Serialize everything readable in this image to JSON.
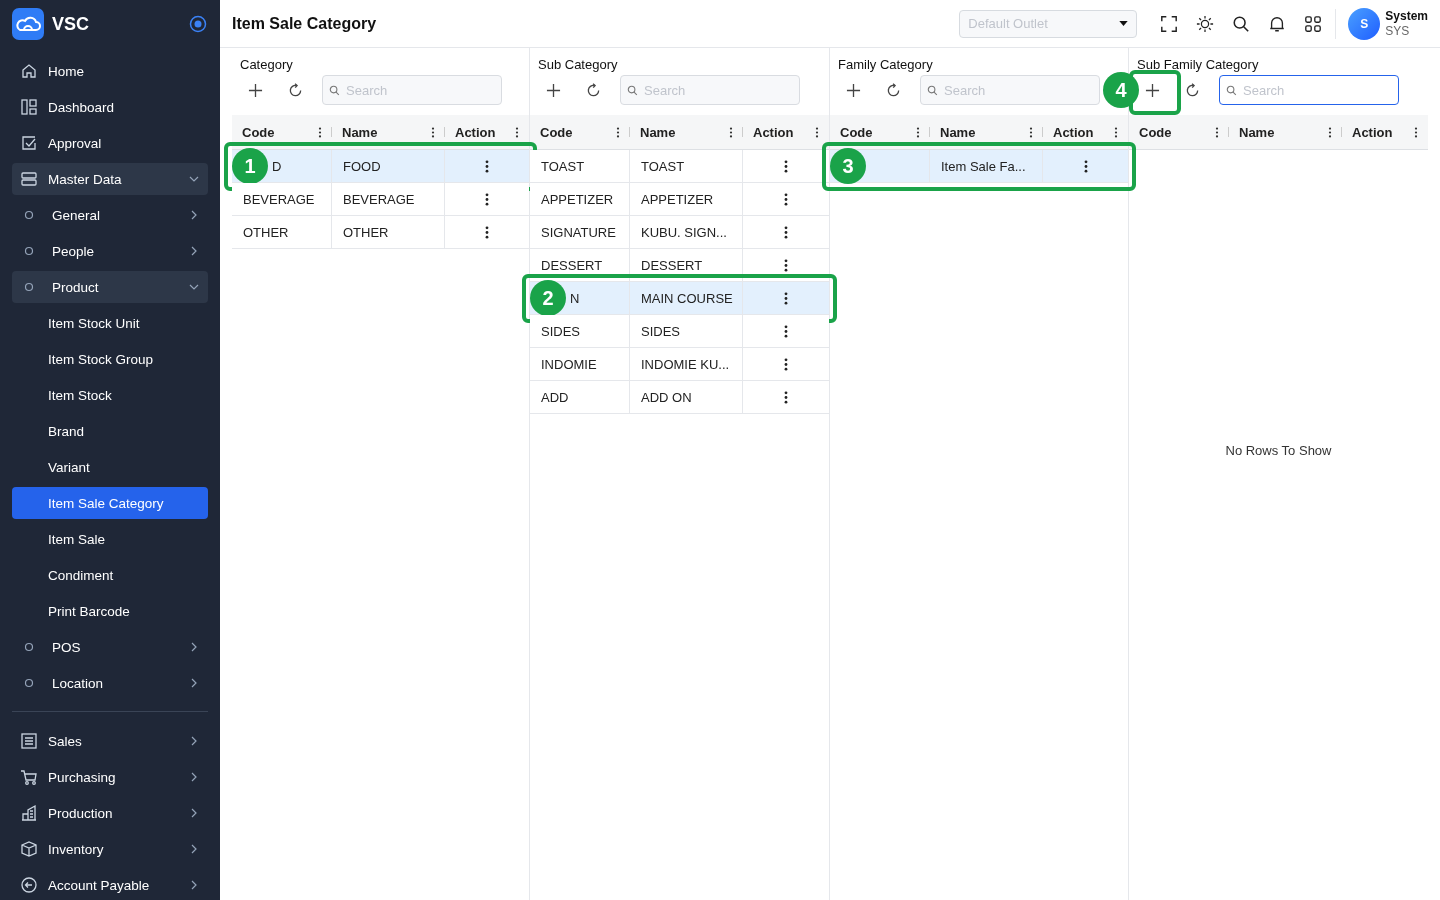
{
  "brand": {
    "name": "VSC"
  },
  "nav": [
    {
      "label": "Home"
    },
    {
      "label": "Dashboard"
    },
    {
      "label": "Approval"
    },
    {
      "label": "Master Data",
      "expanded": true,
      "children": [
        {
          "label": "General",
          "expanded": false
        },
        {
          "label": "People",
          "expanded": false
        },
        {
          "label": "Product",
          "expanded": true,
          "children": [
            {
              "label": "Item Stock Unit",
              "selected": false
            },
            {
              "label": "Item Stock Group",
              "selected": false
            },
            {
              "label": "Item Stock",
              "selected": false
            },
            {
              "label": "Brand",
              "selected": false
            },
            {
              "label": "Variant",
              "selected": false
            },
            {
              "label": "Item Sale Category",
              "selected": true
            },
            {
              "label": "Item Sale",
              "selected": false
            },
            {
              "label": "Condiment",
              "selected": false
            },
            {
              "label": "Print Barcode",
              "selected": false
            }
          ]
        },
        {
          "label": "POS",
          "expanded": false
        },
        {
          "label": "Location",
          "expanded": false
        }
      ]
    }
  ],
  "nav_secondary": [
    {
      "label": "Sales",
      "expanded": false
    },
    {
      "label": "Purchasing",
      "expanded": false
    },
    {
      "label": "Production",
      "expanded": false
    },
    {
      "label": "Inventory",
      "expanded": false
    },
    {
      "label": "Account Payable",
      "expanded": false
    }
  ],
  "page_title": "Item Sale Category",
  "outlet_select": {
    "placeholder": "Default Outlet"
  },
  "user": {
    "initial": "S",
    "name": "System",
    "code": "SYS"
  },
  "panels": [
    {
      "title": "Category",
      "search": {
        "placeholder": "Search",
        "focused": false
      },
      "columns": [
        "Code",
        "Name",
        "Action"
      ],
      "rows": [
        {
          "code": "D",
          "name": "FOOD",
          "selected": true,
          "callout": "1"
        },
        {
          "code": "BEVERAGE",
          "name": "BEVERAGE",
          "selected": false
        },
        {
          "code": "OTHER",
          "name": "OTHER",
          "selected": false
        }
      ]
    },
    {
      "title": "Sub Category",
      "search": {
        "placeholder": "Search",
        "focused": false
      },
      "columns": [
        "Code",
        "Name",
        "Action"
      ],
      "rows": [
        {
          "code": "TOAST",
          "name": "TOAST",
          "selected": false
        },
        {
          "code": "APPETIZER",
          "name": "APPETIZER",
          "selected": false
        },
        {
          "code": "SIGNATURE",
          "name": "KUBU. SIGN...",
          "selected": false
        },
        {
          "code": "DESSERT",
          "name": "DESSERT",
          "selected": false
        },
        {
          "code": "N",
          "name": "MAIN COURSE",
          "selected": true,
          "callout": "2"
        },
        {
          "code": "SIDES",
          "name": "SIDES",
          "selected": false
        },
        {
          "code": "INDOMIE",
          "name": "INDOMIE KU...",
          "selected": false
        },
        {
          "code": "ADD",
          "name": "ADD ON",
          "selected": false
        }
      ]
    },
    {
      "title": "Family Category",
      "search": {
        "placeholder": "Search",
        "focused": false
      },
      "columns": [
        "Code",
        "Name",
        "Action"
      ],
      "rows": [
        {
          "name": "Item Sale Fa...",
          "selected": true,
          "callout": "3"
        }
      ]
    },
    {
      "title": "Sub Family Category",
      "search": {
        "placeholder": "Search",
        "focused": true
      },
      "add_callout": "4",
      "columns": [
        "Code",
        "Name",
        "Action"
      ],
      "empty_text": "No Rows To Show"
    }
  ]
}
